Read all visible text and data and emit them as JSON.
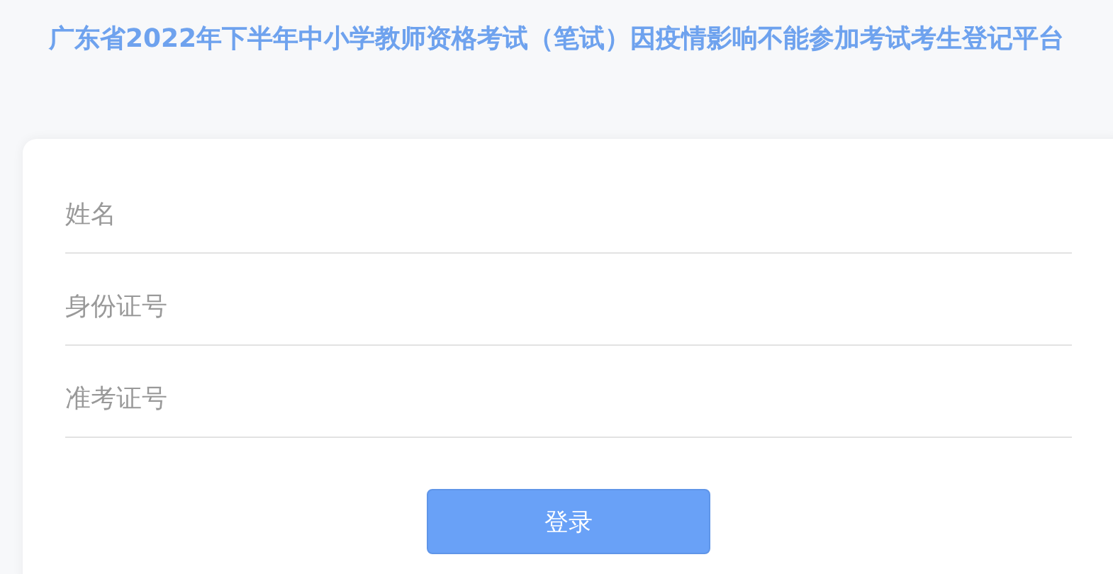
{
  "title": "广东省2022年下半年中小学教师资格考试（笔试）因疫情影响不能参加考试考生登记平台",
  "fields": [
    {
      "placeholder": "姓名"
    },
    {
      "placeholder": "身份证号"
    },
    {
      "placeholder": "准考证号"
    }
  ],
  "submit_button": "登录"
}
